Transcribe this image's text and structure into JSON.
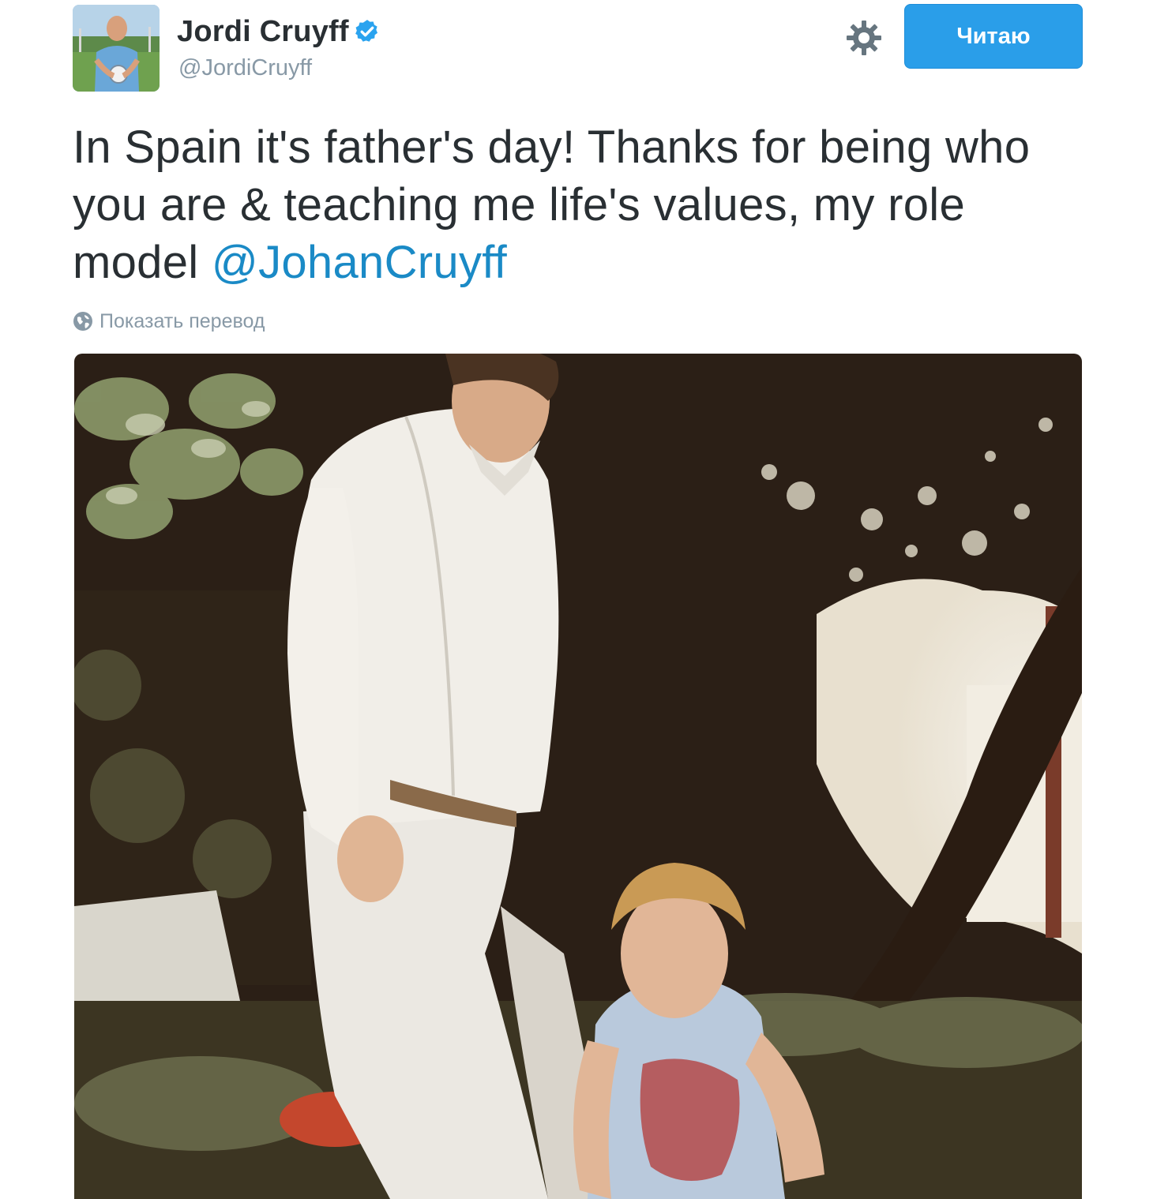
{
  "account": {
    "display_name": "Jordi Cruyff",
    "handle": "@JordiCruyff",
    "verified_icon": "verified-badge-icon",
    "avatar_icon": "avatar-photo"
  },
  "actions": {
    "settings_icon": "gear-icon",
    "follow_label": "Читаю",
    "follow_color": "#2a9ee9"
  },
  "tweet": {
    "text_before": "In Spain it's father's day! Thanks for being who you are & teaching me life's values, my role model ",
    "mention": "@JohanCruyff",
    "mention_color": "#1a8ac6"
  },
  "translate": {
    "icon": "globe-icon",
    "label": "Показать перевод"
  },
  "media": {
    "type": "photo",
    "icon": "attached-photo"
  }
}
